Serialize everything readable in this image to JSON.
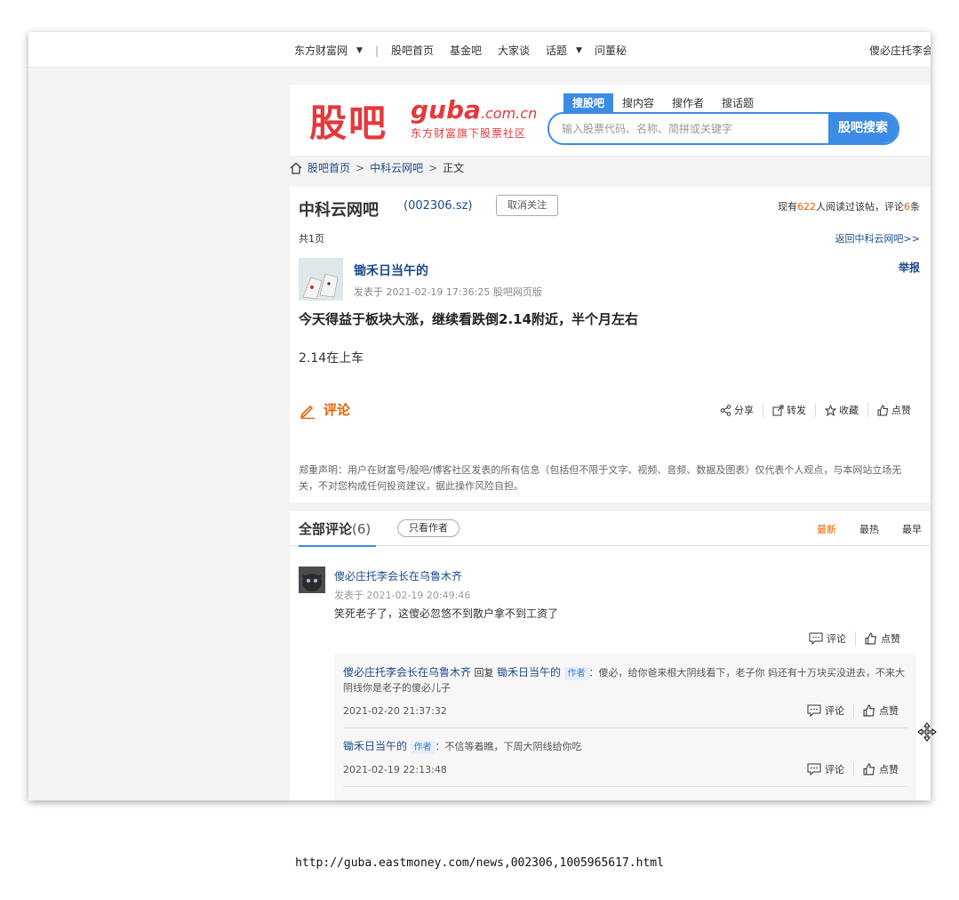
{
  "topbar": {
    "site": "东方财富网",
    "guba_home": "股吧首页",
    "fund_bar": "基金吧",
    "dajiatan": "大家谈",
    "topics": "话题",
    "ask": "问董秘",
    "user": "傻必庄托李会"
  },
  "header": {
    "logo_cn": "股吧",
    "logo_en": "guba",
    "logo_domain": ".com.cn",
    "logo_sub": "东方财富旗下股票社区",
    "search_tabs": [
      "搜股吧",
      "搜内容",
      "搜作者",
      "搜话题"
    ],
    "search_placeholder": "输入股票代码、名称、简拼或关键字",
    "search_button": "股吧搜索"
  },
  "breadcrumb": {
    "home": "股吧首页",
    "bar": "中科云网吧",
    "current": "正文"
  },
  "post": {
    "bar_name": "中科云网吧",
    "code": "(002306.sz)",
    "unfollow": "取消关注",
    "read_prefix": "现有",
    "read_count": "622",
    "read_mid": "人阅读过该帖，评论",
    "comment_count": "6",
    "read_suffix": "条",
    "pages": "共1页",
    "back": "返回中科云网吧>>",
    "author": "锄禾日当午的",
    "meta": "发表于 2021-02-19 17:36:25 股吧网页版",
    "report": "举报",
    "title": "今天得益于板块大涨，继续看跌倒2.14附近，半个月左右",
    "body": "2.14在上车",
    "comment_label": "评论",
    "actions": {
      "share": "分享",
      "forward": "转发",
      "collect": "收藏",
      "like": "点赞"
    },
    "disclaimer": "郑重声明：用户在财富号/股吧/博客社区发表的所有信息（包括但不限于文字、视频、音频、数据及图表）仅代表个人观点，与本网站立场无关，不对您构成任何投资建议，据此操作风险自担。"
  },
  "comments": {
    "tab_all": "全部评论",
    "tab_count": "(6)",
    "only_author": "只看作者",
    "sort": {
      "newest": "最新",
      "hottest": "最热",
      "earliest": "最早"
    },
    "first": {
      "user": "傻必庄托李会长在乌鲁木齐",
      "time": "发表于 2021-02-19 20:49:46",
      "text": "笑死老子了，这傻必忽悠不到散户拿不到工资了",
      "comment": "评论",
      "like": "点赞"
    },
    "replies": [
      {
        "user": "傻必庄托李会长在乌鲁木齐",
        "reply_word": "回复",
        "target": "锄禾日当午的",
        "tag": "作者",
        "text": "：傻必，给你爸来根大阴线看下，老子你 妈还有十万块买没进去，不来大阴线你是老子的傻必儿子",
        "time": "2021-02-20 21:37:32",
        "comment": "评论",
        "like": "点赞"
      },
      {
        "user": "锄禾日当午的",
        "tag": "作者",
        "text": "：不信等着瞧，下周大阴线给你吃",
        "time": "2021-02-19 22:13:48",
        "comment": "评论",
        "like": "点赞"
      }
    ]
  },
  "url": "http://guba.eastmoney.com/news,002306,1005965617.html",
  "colors": {
    "accent": "#3c8be4",
    "brand_red": "#e4393c",
    "orange": "#e85f00",
    "link": "#1d4a8c"
  }
}
